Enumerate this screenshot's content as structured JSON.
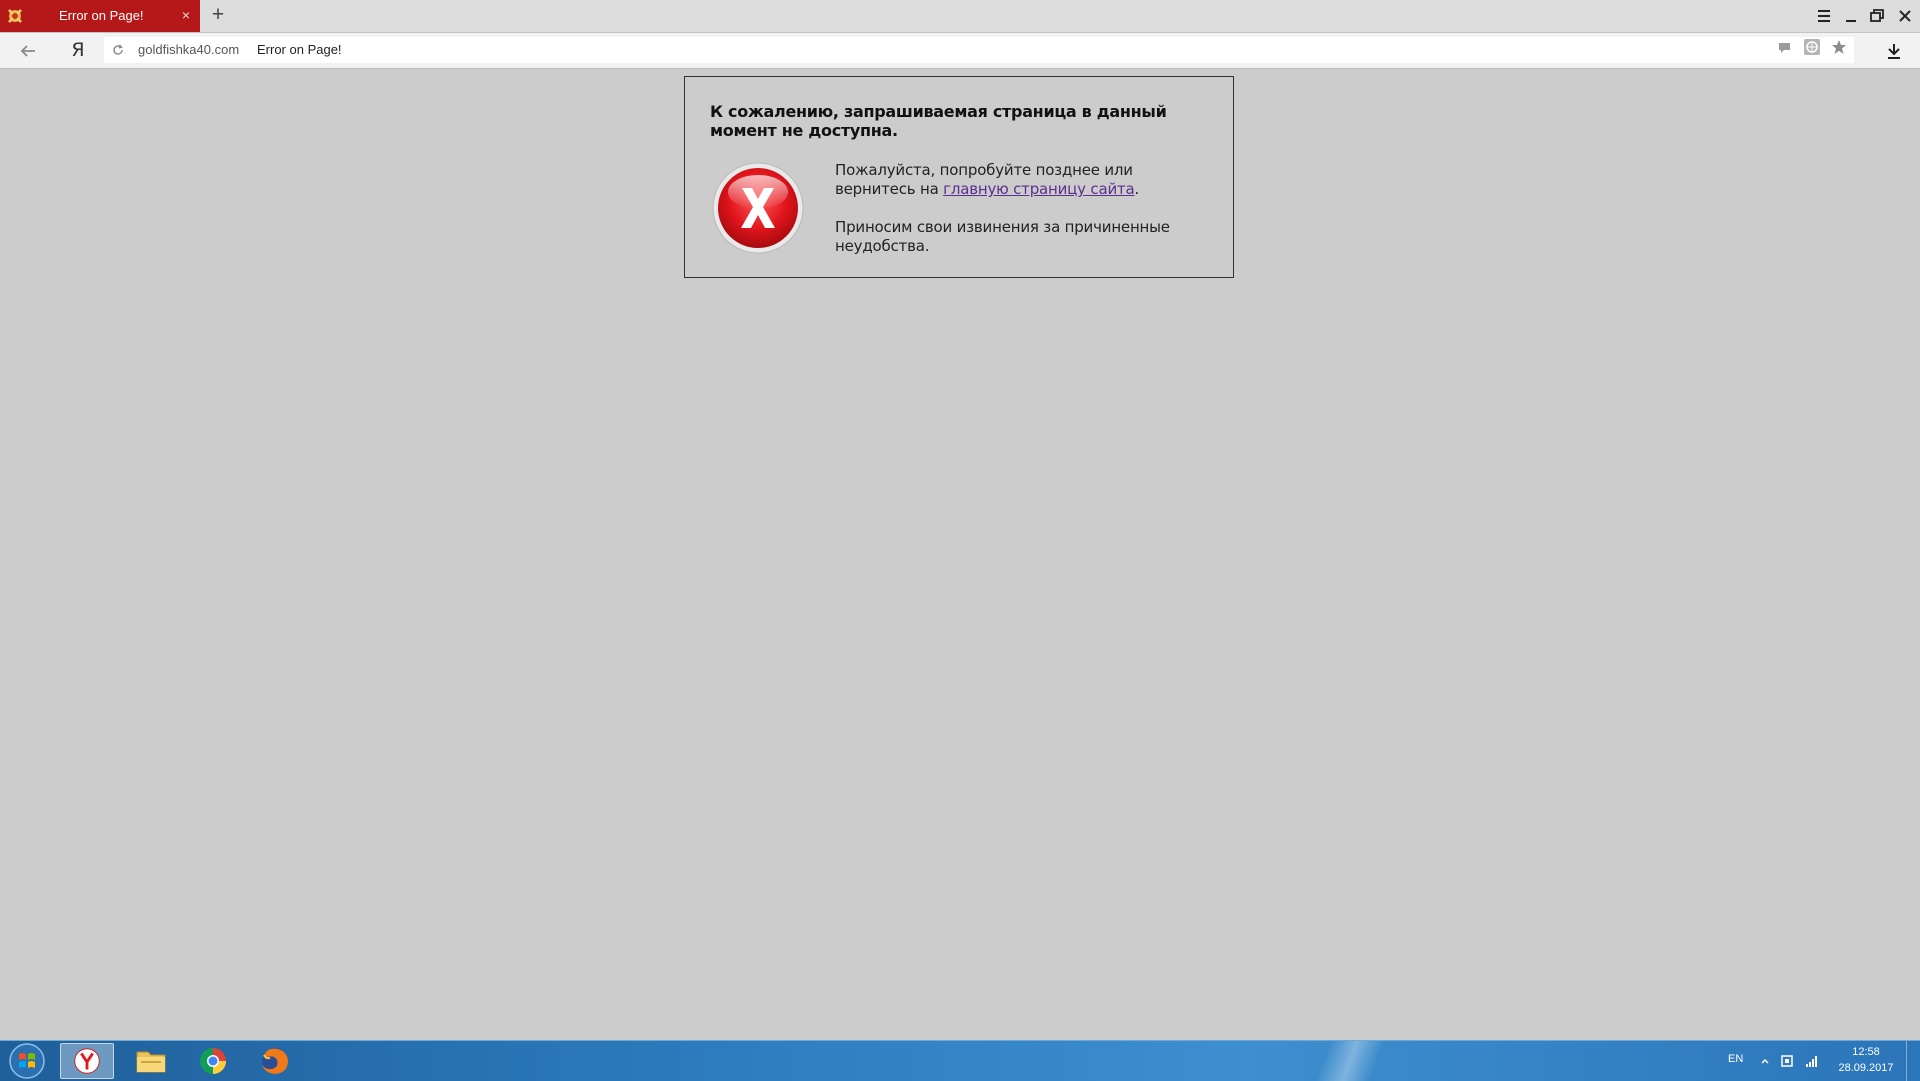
{
  "browser": {
    "tab": {
      "title": "Error on Page!",
      "close_label": "×"
    },
    "new_tab_label": "+",
    "yandex_button": "Я",
    "address": {
      "domain": "goldfishka40.com",
      "page_title": "Error on Page!"
    }
  },
  "error_page": {
    "heading": "К сожалению, запрашиваемая страница в данный момент не доступна.",
    "line1_before": "Пожалуйста, попробуйте позднее или вернитесь на ",
    "link_text": "главную страницу сайта",
    "line1_after": ".",
    "apology": "Приносим свои извинения за причиненные неудобства."
  },
  "taskbar": {
    "apps": [
      "yandex-browser",
      "file-explorer",
      "chrome",
      "firefox"
    ],
    "language": "EN",
    "time": "12:58",
    "date": "28.09.2017"
  },
  "colors": {
    "tab_active": "#b41818",
    "page_background": "#cccccc",
    "link": "#5b2f8e",
    "error_icon": "#e0141b"
  }
}
